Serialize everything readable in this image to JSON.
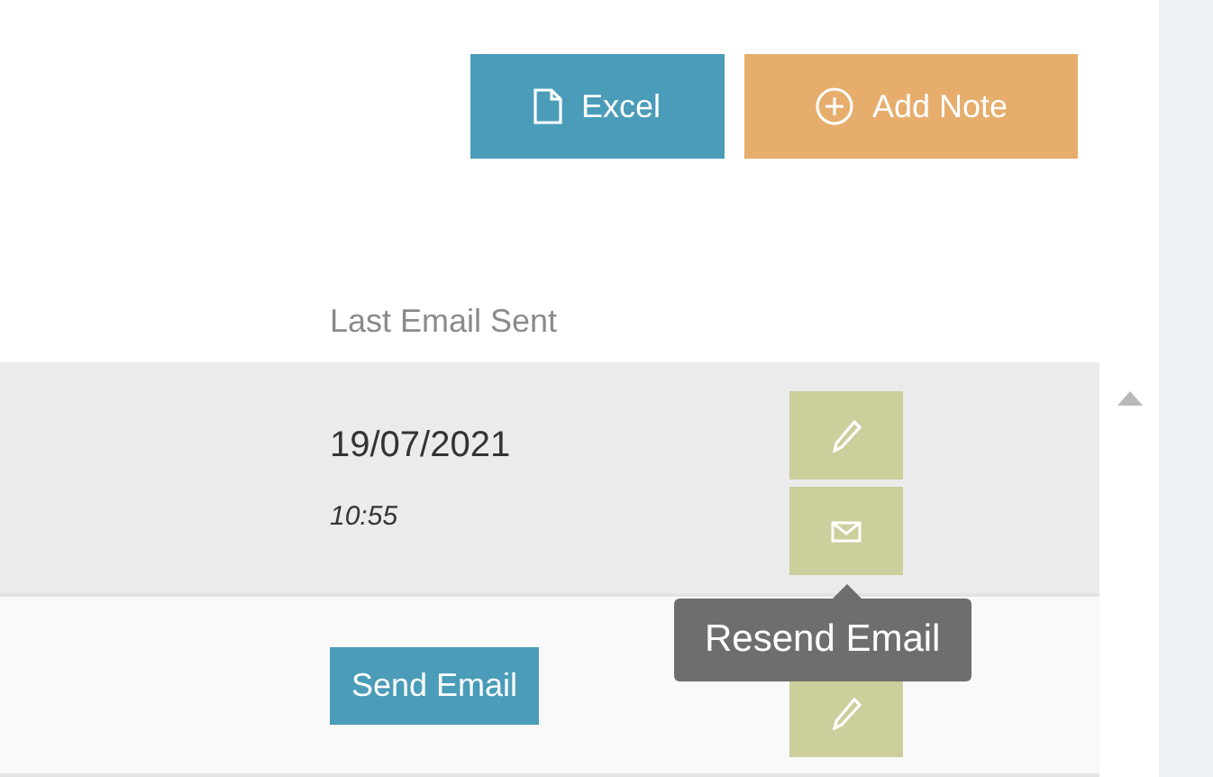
{
  "toolbar": {
    "buttons": [
      {
        "kind": "excel",
        "label": "Excel"
      },
      {
        "kind": "add",
        "label": "Add Note"
      }
    ]
  },
  "table": {
    "columns": [
      "Last Email Sent"
    ],
    "rows": [
      {
        "hovered": true,
        "date": "19/07/2021",
        "time": "10:55",
        "actions": [
          {
            "kind": "edit"
          },
          {
            "kind": "email"
          }
        ]
      },
      {
        "hovered": false,
        "send_button": "Send Email",
        "actions": [
          {
            "kind": "edit"
          }
        ]
      }
    ]
  },
  "tooltip": {
    "text": "Resend Email"
  }
}
